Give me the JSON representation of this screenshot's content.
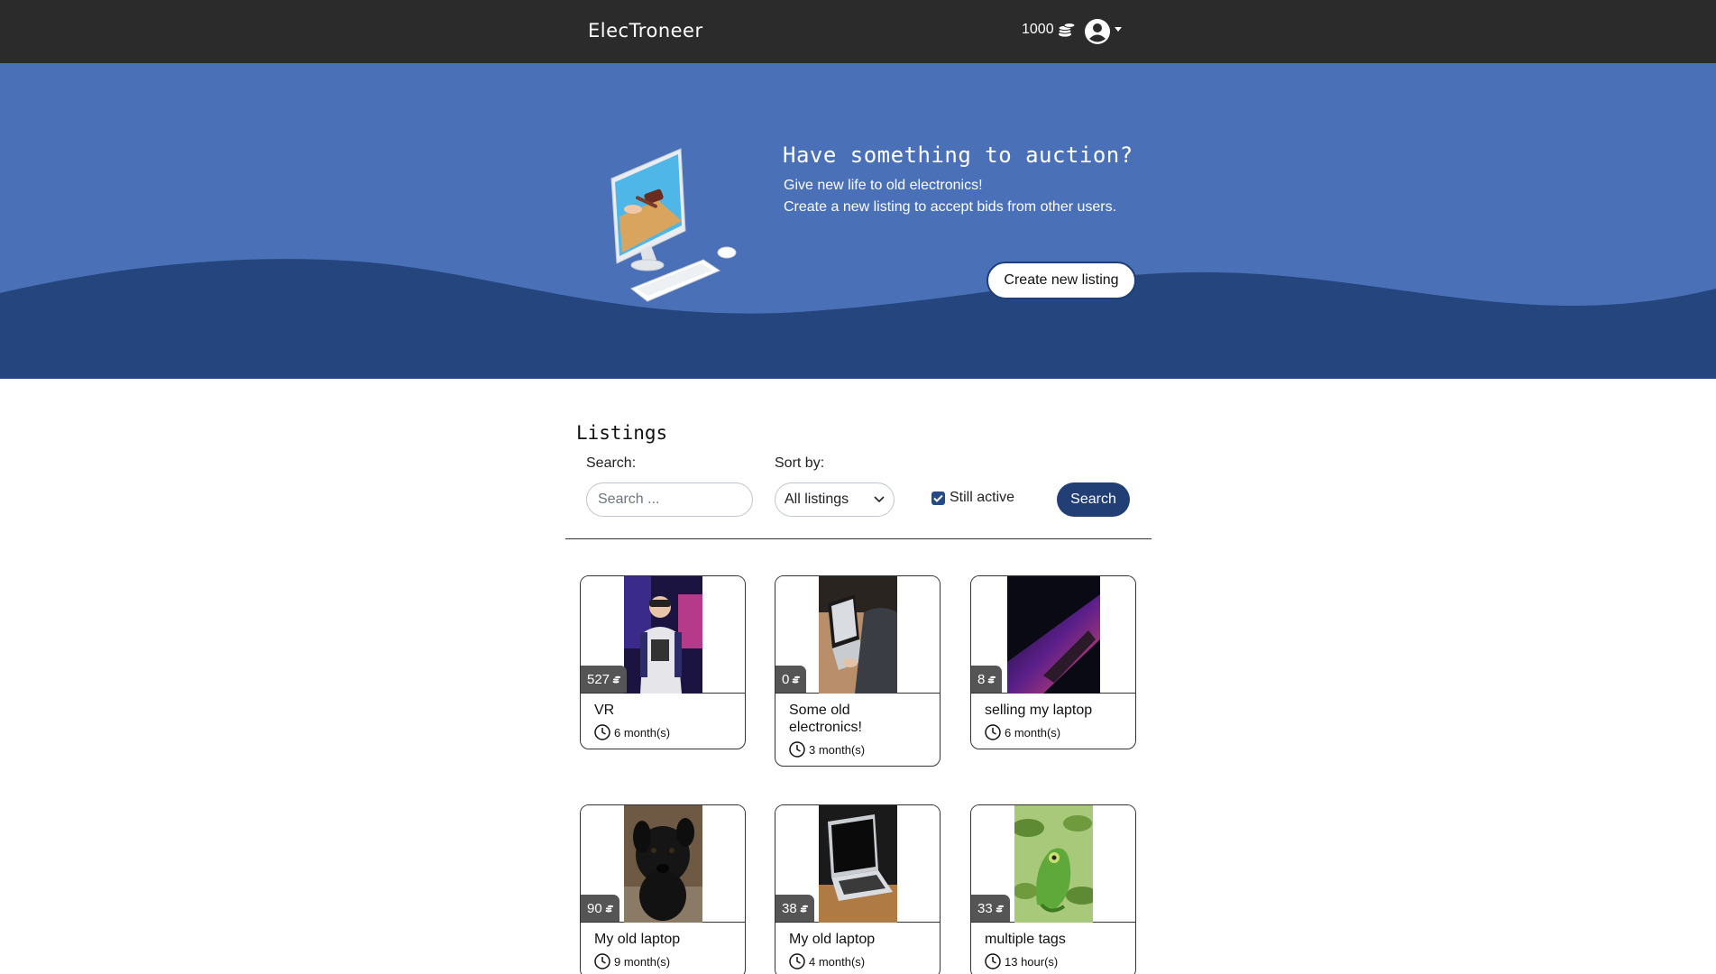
{
  "navbar": {
    "brand": "ElecTroneer",
    "coins": "1000",
    "coin_icon": "coins-stack-icon",
    "user_icon": "user-circle-icon"
  },
  "hero": {
    "title": "Have something to auction?",
    "line1": "Give new life to old electronics!",
    "line2": "Create a new listing to accept bids from other users.",
    "cta": "Create new listing",
    "colors": {
      "light": "#4a70b7",
      "dark": "#24457d"
    }
  },
  "listings": {
    "title": "Listings",
    "search_label": "Search:",
    "search_placeholder": "Search ...",
    "sort_label": "Sort by:",
    "sort_value": "All listings",
    "still_active_label": "Still active",
    "still_active_checked": true,
    "search_button": "Search",
    "items": [
      {
        "bids": "527",
        "title": "VR",
        "time": "6 month(s)"
      },
      {
        "bids": "0",
        "title": "Some old electronics!",
        "time": "3 month(s)"
      },
      {
        "bids": "8",
        "title": "selling my laptop",
        "time": "6 month(s)"
      },
      {
        "bids": "90",
        "title": "My old laptop",
        "time": "9 month(s)"
      },
      {
        "bids": "38",
        "title": "My old laptop",
        "time": "4 month(s)"
      },
      {
        "bids": "33",
        "title": "multiple tags",
        "time": "13 hour(s)"
      }
    ]
  }
}
